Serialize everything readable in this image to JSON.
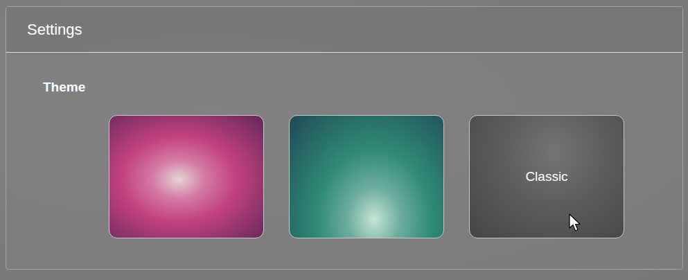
{
  "window": {
    "title": "Settings"
  },
  "theme": {
    "label": "Theme",
    "options": [
      {
        "color": "#c2417f"
      },
      {
        "color": "#2f8a76"
      },
      {
        "label": "Classic",
        "color": "#5c5c5c"
      }
    ]
  }
}
